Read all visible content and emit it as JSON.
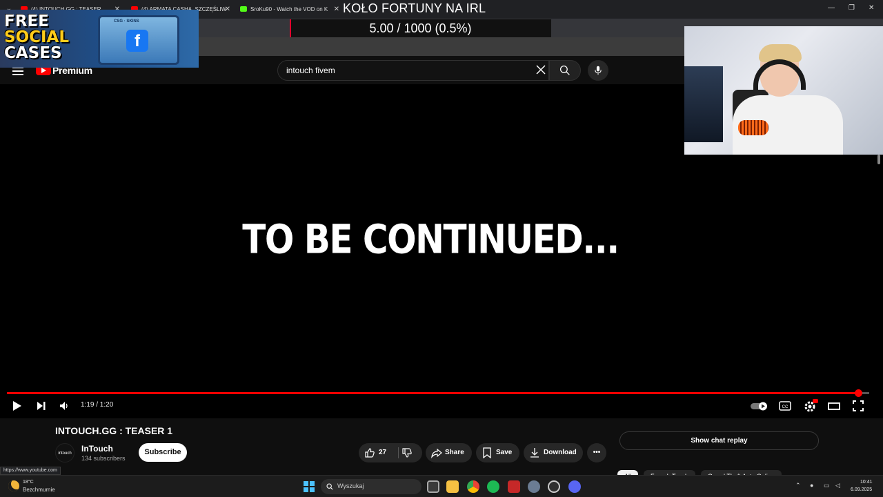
{
  "browser": {
    "tabs": [
      {
        "title": "(4) INTOUCH.GG : TEASER"
      },
      {
        "title": "(4) ARMATA CASHA, SZCZĘŚLIW"
      },
      {
        "title": "SroKu90 - Watch the VOD on K"
      }
    ],
    "status_url": "https://www.youtube.com"
  },
  "overlays": {
    "promo": {
      "line1": "FREE",
      "line2": "SOCIAL",
      "line3": "CASES",
      "chest_label": "CSG · SKINS",
      "chest_icon": "facebook-icon"
    },
    "stream_title": "KOŁO FORTUNY NA IRL",
    "goal": {
      "text": "5.00 / 1000 (0.5%)",
      "progress": 0.005
    }
  },
  "youtube": {
    "logo_label": "Premium",
    "search": {
      "value": "intouch fivem"
    },
    "video": {
      "overlay_text": "TO BE CONTINUED...",
      "time": "1:19 / 1:20",
      "progress": 0.9875,
      "title": "INTOUCH.GG : TEASER 1"
    },
    "channel": {
      "avatar_text": "intouch",
      "name": "InTouch",
      "subscribers": "134 subscribers",
      "subscribe_label": "Subscribe"
    },
    "actions": {
      "likes": "27",
      "share": "Share",
      "save": "Save",
      "download": "Download"
    },
    "chat_replay": "Show chat replay",
    "chips": [
      "All",
      "From InTouch",
      "Grand Theft Auto Online"
    ]
  },
  "taskbar": {
    "weather_temp": "18°C",
    "weather_desc": "Bezchmurnie",
    "search_label": "Wyszukaj",
    "time": "10:41",
    "date": "6.09.2025"
  },
  "colors": {
    "accent": "#ff0000",
    "goal_bar": "#e1002d",
    "win_accent": "#4cc2ff"
  }
}
